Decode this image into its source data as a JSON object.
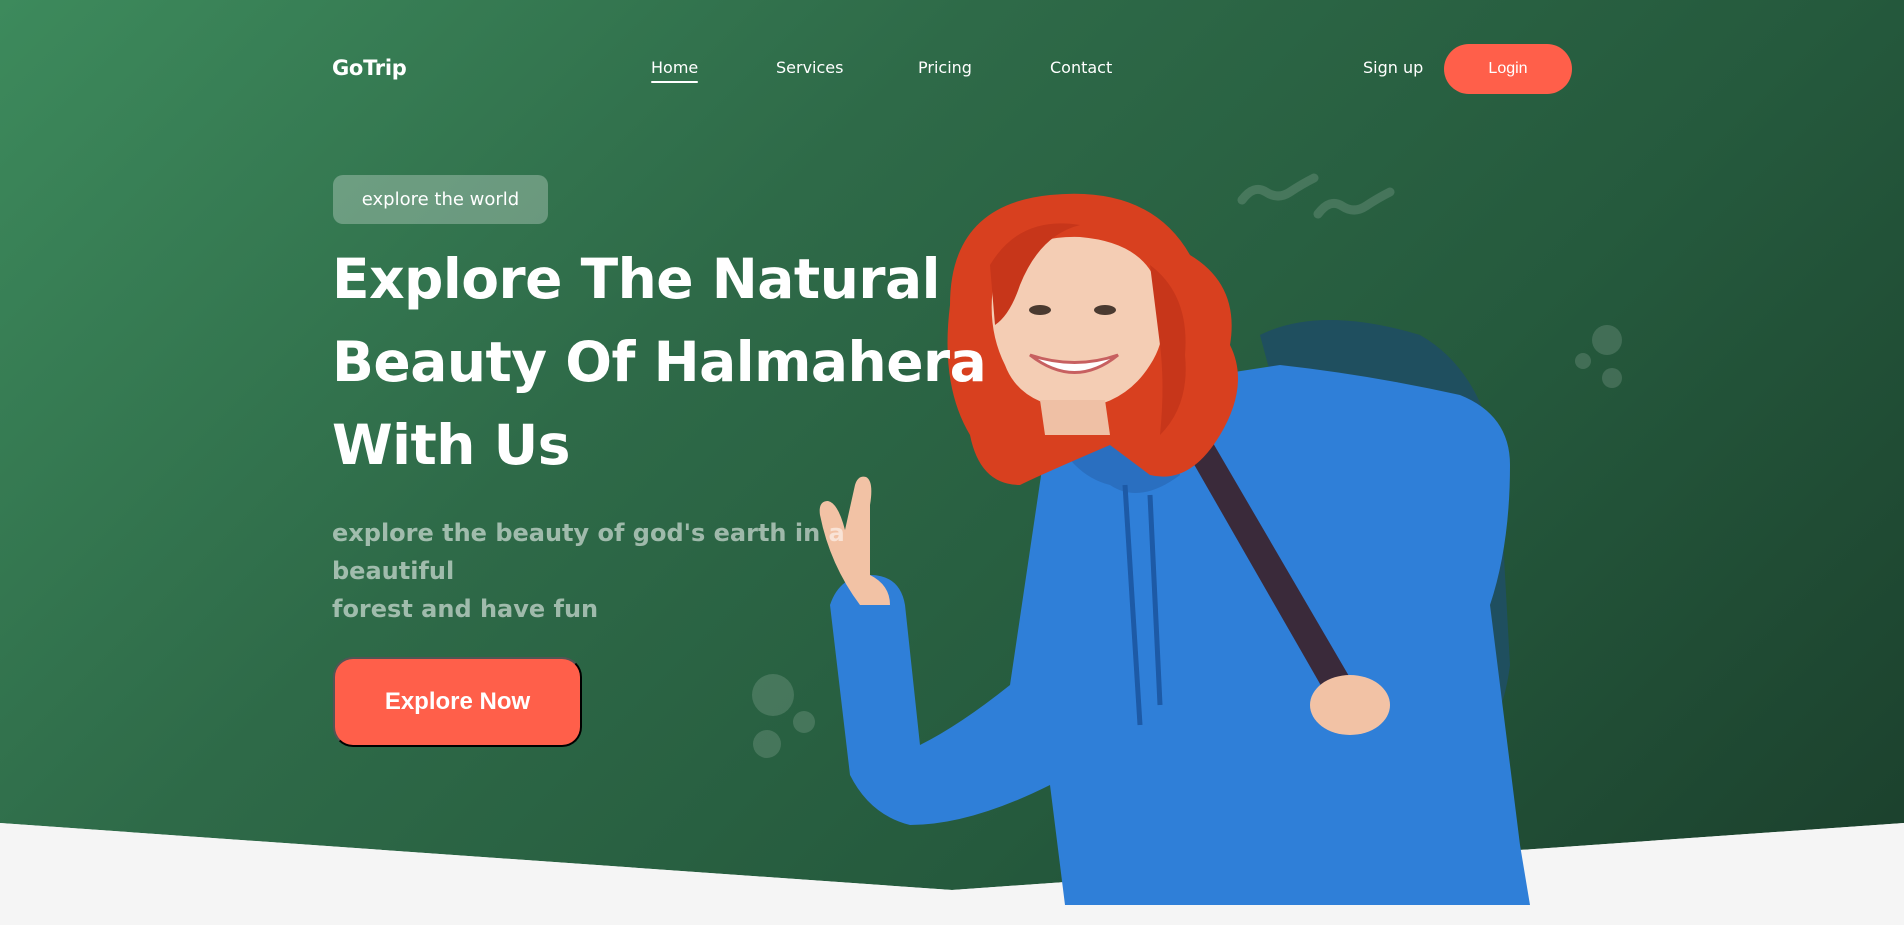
{
  "brand": {
    "logo_text": "GoTrip"
  },
  "nav": {
    "items": [
      {
        "label": "Home",
        "active": true
      },
      {
        "label": "Services",
        "active": false
      },
      {
        "label": "Pricing",
        "active": false
      },
      {
        "label": "Contact",
        "active": false
      }
    ],
    "signup_label": "Sign up",
    "login_label": "Login"
  },
  "hero": {
    "badge": "explore the world",
    "headline_lines": [
      "Explore The Natural",
      "Beauty Of Halmahera",
      "With Us"
    ],
    "subtitle_lines": [
      "explore the beauty of god's earth in a beautiful",
      "forest and have fun"
    ],
    "cta_label": "Explore Now"
  },
  "colors": {
    "accent": "#ff5f4a",
    "hero_green": "#2e6a48",
    "hoodie_blue": "#2f7fd8",
    "hair_red": "#d8401f"
  },
  "icons": [
    "squiggle-decoration-icon",
    "dots-decoration-icon"
  ]
}
